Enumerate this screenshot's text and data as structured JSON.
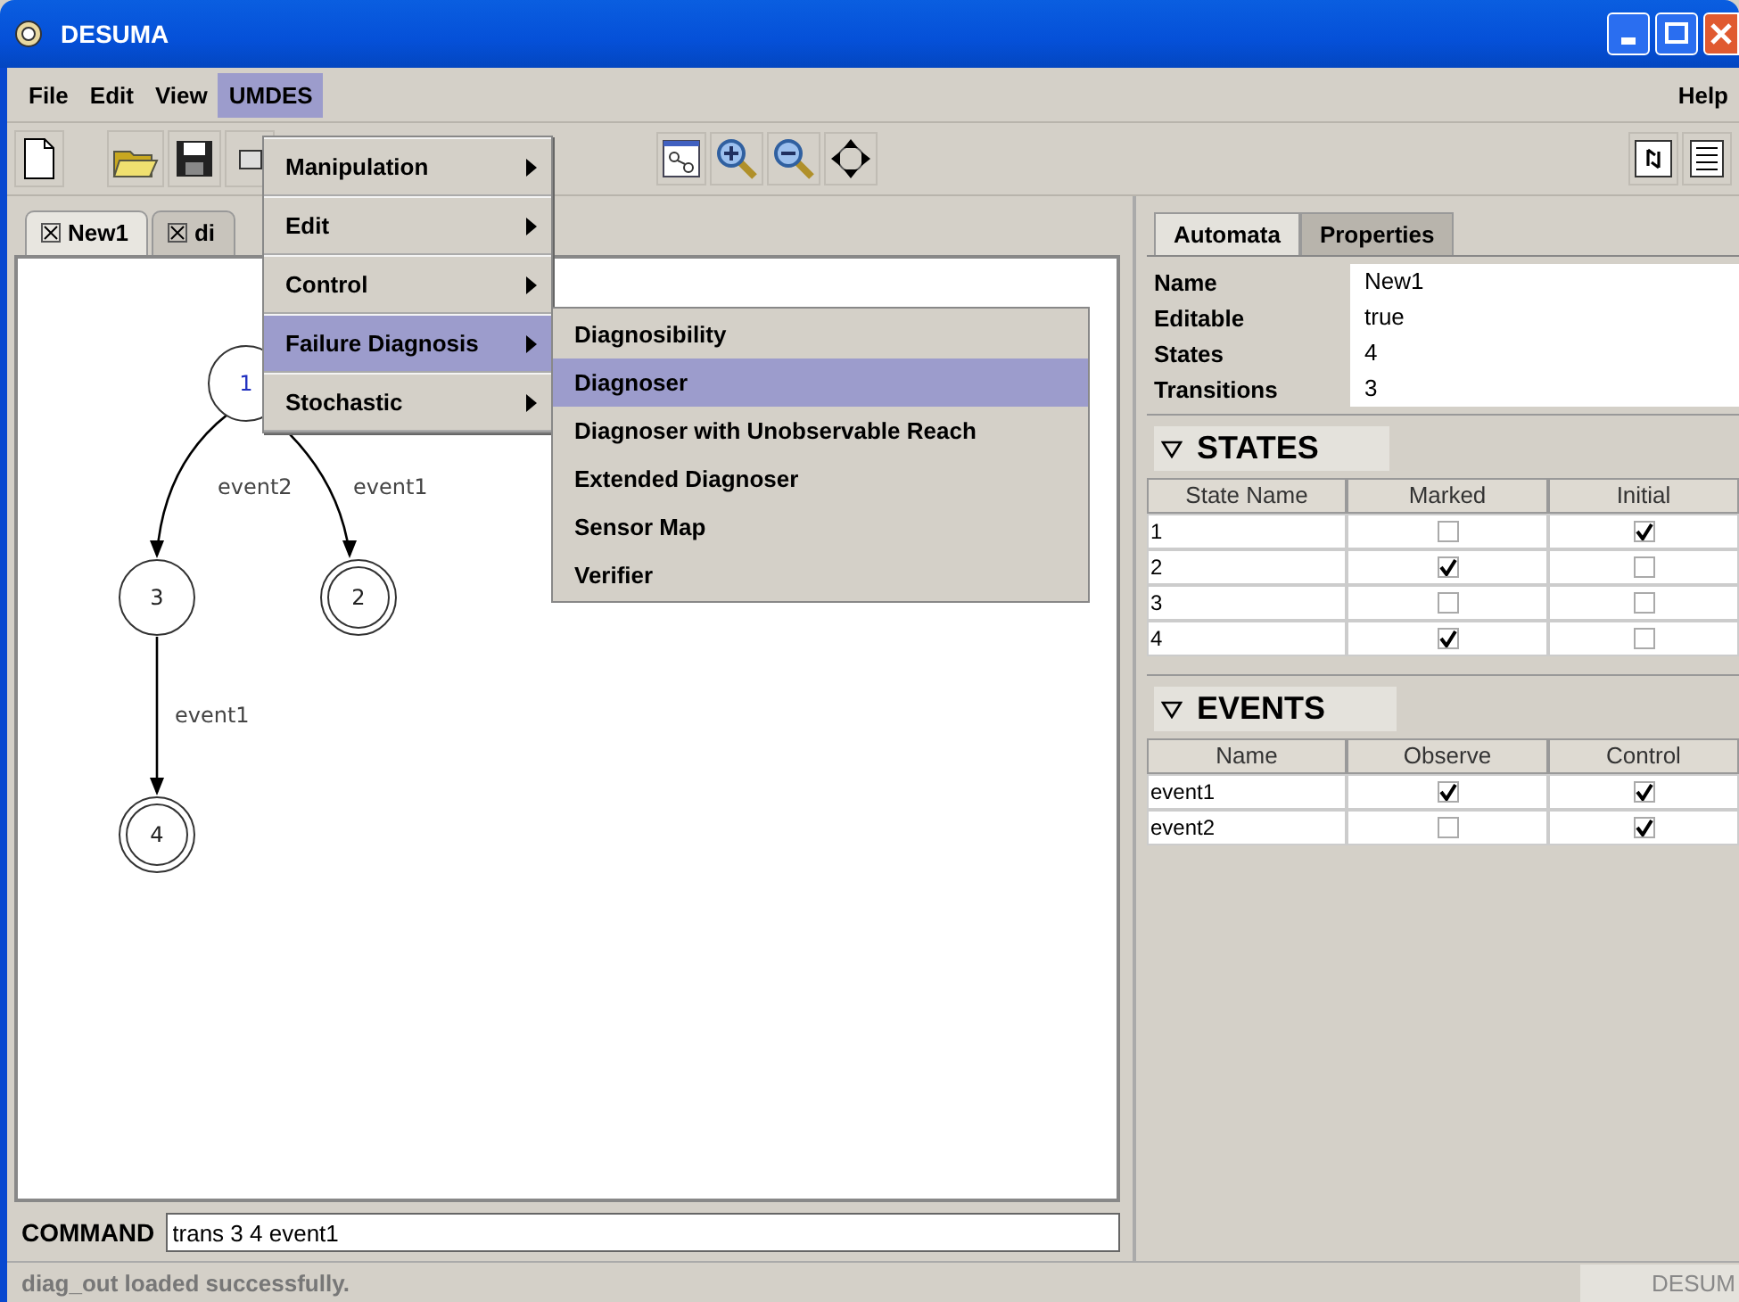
{
  "window": {
    "title": "DESUMA"
  },
  "menubar": {
    "items": [
      {
        "label": "File",
        "selected": false
      },
      {
        "label": "Edit",
        "selected": false
      },
      {
        "label": "View",
        "selected": false
      },
      {
        "label": "UMDES",
        "selected": true
      }
    ],
    "help": "Help"
  },
  "open_menu": {
    "items": [
      {
        "label": "Manipulation",
        "selected": false
      },
      {
        "label": "Edit",
        "selected": false
      },
      {
        "label": "Control",
        "selected": false
      },
      {
        "label": "Failure Diagnosis",
        "selected": true
      },
      {
        "label": "Stochastic",
        "selected": false
      }
    ],
    "submenu": [
      {
        "label": "Diagnosibility",
        "selected": false
      },
      {
        "label": "Diagnoser",
        "selected": true
      },
      {
        "label": "Diagnoser with Unobservable Reach",
        "selected": false
      },
      {
        "label": "Extended Diagnoser",
        "selected": false
      },
      {
        "label": "Sensor Map",
        "selected": false
      },
      {
        "label": "Verifier",
        "selected": false
      }
    ]
  },
  "editor_tabs": [
    {
      "label": "New1",
      "selected": true
    },
    {
      "label": "di",
      "selected": false
    }
  ],
  "graph": {
    "nodes": [
      {
        "label": "1",
        "marked": false,
        "selected": true
      },
      {
        "label": "2",
        "marked": true,
        "selected": false
      },
      {
        "label": "3",
        "marked": false,
        "selected": false
      },
      {
        "label": "4",
        "marked": true,
        "selected": false
      }
    ],
    "edges": [
      {
        "label": "event2"
      },
      {
        "label": "event1"
      },
      {
        "label": "event1"
      }
    ]
  },
  "command": {
    "label": "COMMAND",
    "value": "trans 3 4 event1"
  },
  "status": {
    "message": "diag_out loaded successfully.",
    "right": "DESUM"
  },
  "side_tabs": [
    {
      "label": "Automata",
      "selected": true
    },
    {
      "label": "Properties",
      "selected": false
    }
  ],
  "properties": [
    {
      "name": "Name",
      "value": "New1"
    },
    {
      "name": "Editable",
      "value": "true"
    },
    {
      "name": "States",
      "value": "4"
    },
    {
      "name": "Transitions",
      "value": "3"
    }
  ],
  "states": {
    "title": "STATES",
    "columns": [
      "State Name",
      "Marked",
      "Initial"
    ],
    "rows": [
      {
        "name": "1",
        "marked": false,
        "initial": true
      },
      {
        "name": "2",
        "marked": true,
        "initial": false
      },
      {
        "name": "3",
        "marked": false,
        "initial": false
      },
      {
        "name": "4",
        "marked": true,
        "initial": false
      }
    ]
  },
  "events": {
    "title": "EVENTS",
    "columns": [
      "Name",
      "Observe",
      "Control"
    ],
    "rows": [
      {
        "name": "event1",
        "observe": true,
        "control": true
      },
      {
        "name": "event2",
        "observe": false,
        "control": true
      }
    ]
  }
}
